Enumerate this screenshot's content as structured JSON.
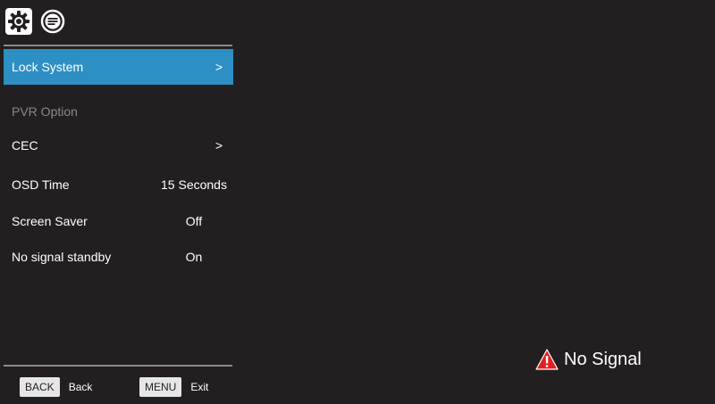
{
  "toolbar": {
    "icons": [
      "gear-icon",
      "menu-list-icon"
    ],
    "active_icon": "gear-icon"
  },
  "menu": {
    "items": [
      {
        "label": "Lock System",
        "value": "",
        "arrow": ">",
        "state": "selected"
      },
      {
        "label": "PVR Option",
        "value": "",
        "arrow": "",
        "state": "disabled"
      },
      {
        "label": "CEC",
        "value": "",
        "arrow": ">",
        "state": "normal"
      },
      {
        "label": "OSD Time",
        "value": "15 Seconds",
        "arrow": "",
        "state": "normal"
      },
      {
        "label": "Screen Saver",
        "value": "Off",
        "arrow": "",
        "state": "normal"
      },
      {
        "label": "No signal standby",
        "value": "On",
        "arrow": "",
        "state": "normal"
      }
    ]
  },
  "footer": {
    "back_key": "BACK",
    "back_label": "Back",
    "menu_key": "MENU",
    "menu_label": "Exit"
  },
  "status": {
    "no_signal": "No Signal",
    "warning_icon": "warning-triangle-icon",
    "warning_color": "#e02020"
  },
  "colors": {
    "background": "#231f20",
    "selected": "#2d8fc3",
    "disabled_text": "#8a8a8a",
    "divider": "#8a8a8a"
  }
}
